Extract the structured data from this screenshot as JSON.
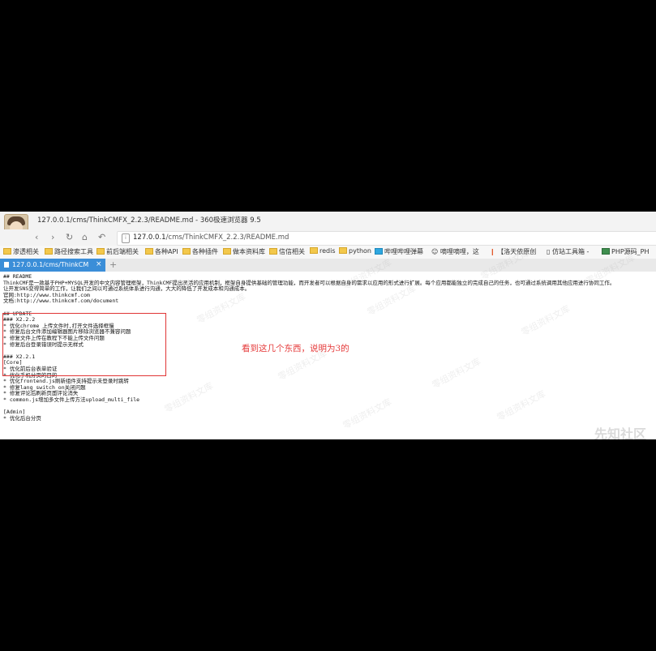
{
  "window": {
    "title": "127.0.0.1/cms/ThinkCMFX_2.2.3/README.md - 360极速浏览器 9.5"
  },
  "nav": {
    "back_icon": "chevron-left-icon",
    "forward_icon": "chevron-right-icon",
    "reload_icon": "reload-icon",
    "home_icon": "home-icon",
    "undo_icon": "undo-icon",
    "url_host": "127.0.0.1",
    "url_path": "/cms/ThinkCMFX_2.2.3/README.md"
  },
  "bookmarks": [
    "渗透相关",
    "路径搜索工具",
    "前后端相关",
    "各种API",
    "各种插件",
    "做本资料库",
    "信信相关",
    "redis",
    "python",
    "哔哩哔哩弹幕",
    "嘀哩嘀哩，这",
    "【洛天依原创",
    "仿站工具箱 -",
    "PHP源码_PH"
  ],
  "tab": {
    "label": "127.0.0.1/cms/ThinkCM",
    "close": "×",
    "new_tab": "+"
  },
  "readme": {
    "lines": [
      "## README",
      "ThinkCMF是一款基于PHP+MYSQL开发的中文内容管理框架，ThinkCMF提出灵活的应用机制，框架自身提供基础的管理功能，而开发者可以根据自身的需求以应用的形式进行扩展。每个应用都能独立的完成自己的任务，也可通过系统调用其他应用进行协同工作。",
      "让开发SNS变得简单的工作，让我们之间以可通过系统体系进行沟通，大大的降低了开发成本和沟通成本。",
      "官网:http://www.thinkcmf.com",
      "文档:http://www.thinkcmf.com/document",
      "",
      "## UPDATE",
      "### X2.2.2",
      "* 优化chrome 上传文件时,打开文件选择框慢",
      "* 修复后台文件添加编辑器图片移除浏览器不兼容问题",
      "* 修复文件上传在教程下不能上传文件问题",
      "* 修复后台登录错误时提示无样式",
      "",
      "### X2.2.1",
      "[Core]",
      "* 优化前后台表单验证",
      "* 优化手机分页的目的",
      "* 优化frontend.js刷新组件支持提示未登录时跳转",
      "* 修复lang_switch_on关闭问题",
      "* 修复评论后刷新页面评论消失",
      "* common.js增加多文件上传方法upload_multi_file",
      "",
      "[Admin]",
      "* 优化后台分页"
    ]
  },
  "annotation": "看到这几个东西，说明为3的",
  "watermark": {
    "text": "零组资料文库",
    "corner": "先知社区"
  }
}
